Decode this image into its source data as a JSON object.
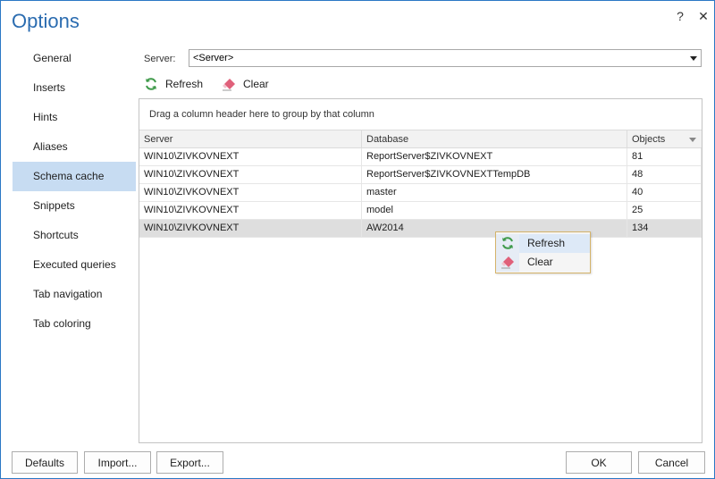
{
  "window": {
    "title": "Options",
    "help_label": "?",
    "close_label": "✕"
  },
  "sidebar": {
    "items": [
      {
        "label": "General"
      },
      {
        "label": "Inserts"
      },
      {
        "label": "Hints"
      },
      {
        "label": "Aliases"
      },
      {
        "label": "Schema cache",
        "selected": true
      },
      {
        "label": "Snippets"
      },
      {
        "label": "Shortcuts"
      },
      {
        "label": "Executed queries"
      },
      {
        "label": "Tab navigation"
      },
      {
        "label": "Tab coloring"
      }
    ]
  },
  "server": {
    "label": "Server:",
    "value": "<Server>"
  },
  "toolbar": {
    "refresh_label": "Refresh",
    "clear_label": "Clear"
  },
  "grid": {
    "group_hint": "Drag a column header here to group by that column",
    "columns": [
      "Server",
      "Database",
      "Objects"
    ],
    "rows": [
      {
        "server": "WIN10\\ZIVKOVNEXT",
        "database": "ReportServer$ZIVKOVNEXT",
        "objects": "81"
      },
      {
        "server": "WIN10\\ZIVKOVNEXT",
        "database": "ReportServer$ZIVKOVNEXTTempDB",
        "objects": "48"
      },
      {
        "server": "WIN10\\ZIVKOVNEXT",
        "database": "master",
        "objects": "40"
      },
      {
        "server": "WIN10\\ZIVKOVNEXT",
        "database": "model",
        "objects": "25"
      },
      {
        "server": "WIN10\\ZIVKOVNEXT",
        "database": "AW2014",
        "objects": "134",
        "selected": true
      }
    ]
  },
  "context_menu": {
    "refresh_label": "Refresh",
    "clear_label": "Clear"
  },
  "footer": {
    "defaults_label": "Defaults",
    "import_label": "Import...",
    "export_label": "Export...",
    "ok_label": "OK",
    "cancel_label": "Cancel"
  },
  "colors": {
    "accent": "#2b6cb0",
    "selected_nav": "#c7dcf2",
    "selected_row": "#dedede",
    "refresh_icon": "#3f9a4a",
    "eraser_icon": "#e0607a"
  },
  "icons": {
    "refresh": "refresh-icon",
    "clear": "eraser-icon"
  }
}
